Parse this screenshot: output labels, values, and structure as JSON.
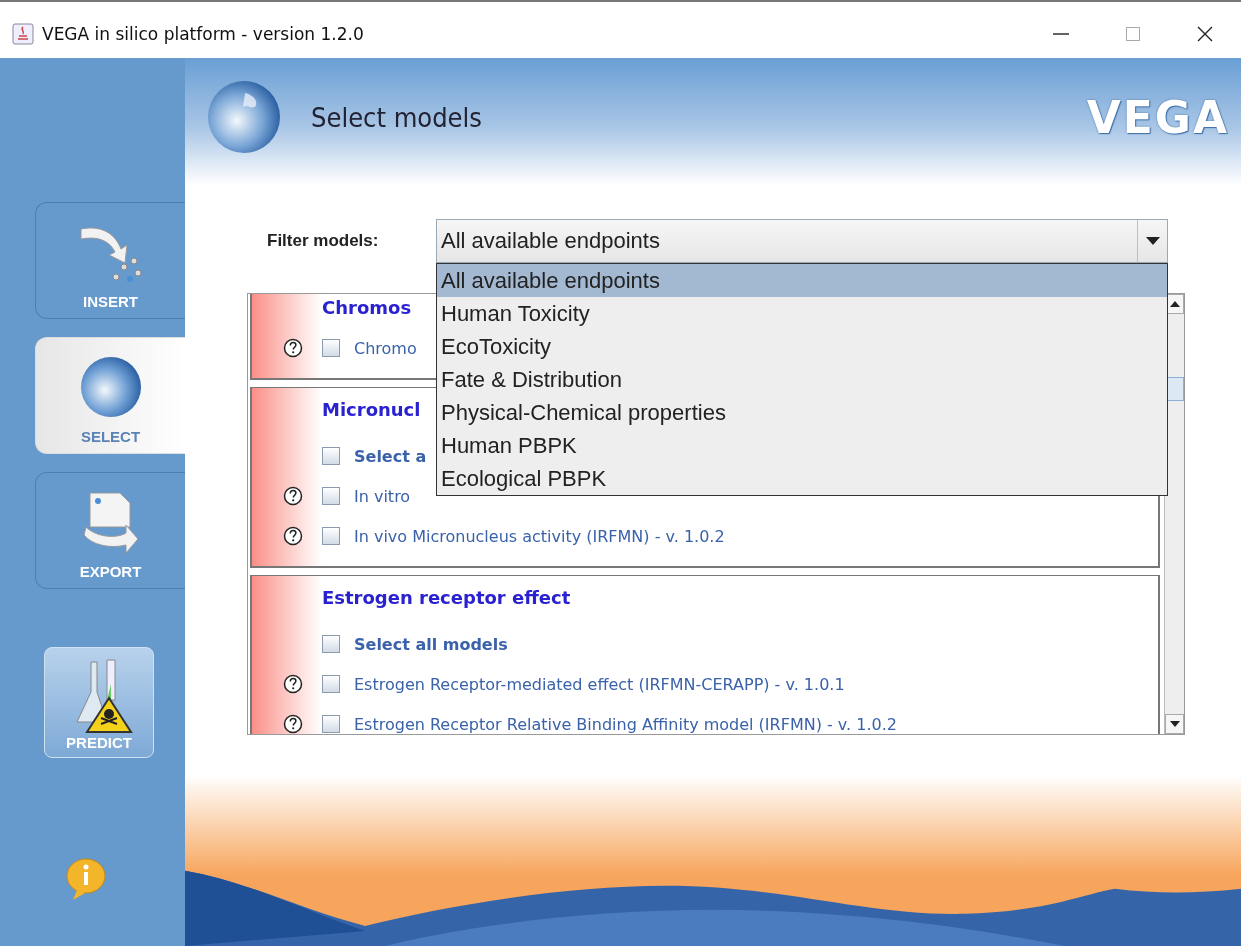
{
  "window": {
    "title": "VEGA in silico platform - version 1.2.0"
  },
  "header": {
    "title": "Select models",
    "logo": "VEGA"
  },
  "sidebar": {
    "items": [
      {
        "label": "INSERT",
        "selected": false,
        "kind": "insert"
      },
      {
        "label": "SELECT",
        "selected": true,
        "kind": "select"
      },
      {
        "label": "EXPORT",
        "selected": false,
        "kind": "export"
      }
    ],
    "predict_button": "PREDICT"
  },
  "filter": {
    "label": "Filter models:",
    "value": "All available endpoints",
    "expanded": true,
    "options": [
      {
        "label": "All available endpoints",
        "selected": true
      },
      {
        "label": "Human Toxicity",
        "selected": false
      },
      {
        "label": "EcoToxicity",
        "selected": false
      },
      {
        "label": "Fate & Distribution",
        "selected": false
      },
      {
        "label": "Physical-Chemical properties",
        "selected": false
      },
      {
        "label": "Human PBPK",
        "selected": false
      },
      {
        "label": "Ecological PBPK",
        "selected": false
      }
    ]
  },
  "groups": [
    {
      "title": "Chromos",
      "models": [
        {
          "label": "Chromo",
          "kind": "model",
          "checked": false
        }
      ]
    },
    {
      "title": "Micronucl",
      "models": [
        {
          "label": "Select a",
          "kind": "select_all",
          "checked": false
        },
        {
          "label": "In vitro",
          "kind": "model",
          "checked": false
        },
        {
          "label": "In vivo Micronucleus activity (IRFMN) - v. 1.0.2",
          "kind": "model",
          "checked": false
        }
      ]
    },
    {
      "title": "Estrogen receptor effect",
      "models": [
        {
          "label": "Select all models",
          "kind": "select_all",
          "checked": false
        },
        {
          "label": "Estrogen Receptor-mediated effect (IRFMN-CERAPP) - v. 1.0.1",
          "kind": "model",
          "checked": false
        },
        {
          "label": "Estrogen Receptor Relative Binding Affinity model (IRFMN) - v. 1.0.2",
          "kind": "model",
          "checked": false
        }
      ]
    }
  ]
}
